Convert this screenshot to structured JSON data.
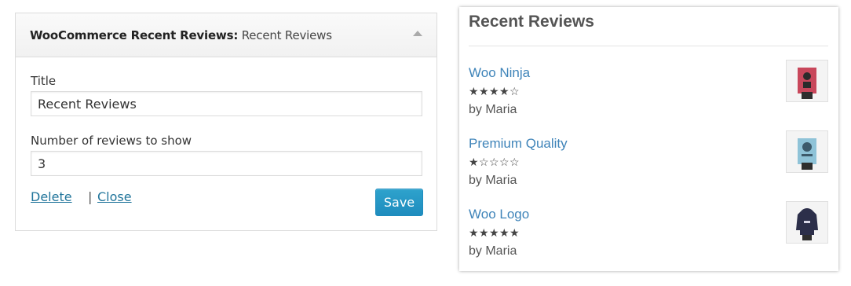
{
  "widget": {
    "header_main": "WooCommerce Recent Reviews:",
    "header_sub": " Recent Reviews",
    "title_label": "Title",
    "title_value": "Recent Reviews",
    "count_label": "Number of reviews to show",
    "count_value": "3",
    "delete_link": "Delete",
    "separator": "|",
    "close_link": "Close",
    "save_button": "Save",
    "toggle_icon": "triangle-up-icon"
  },
  "preview": {
    "heading": "Recent Reviews",
    "reviews": [
      {
        "product": "Woo Ninja",
        "rating": 4,
        "max_rating": 5,
        "author": "by Maria",
        "thumbnail": "poster-ninja-image"
      },
      {
        "product": "Premium Quality",
        "rating": 1,
        "max_rating": 5,
        "author": "by Maria",
        "thumbnail": "poster-premium-quality-image"
      },
      {
        "product": "Woo Logo",
        "rating": 5,
        "max_rating": 5,
        "author": "by Maria",
        "thumbnail": "hoodie-woo-logo-image"
      }
    ]
  },
  "colors": {
    "link": "#21759b",
    "review_link": "#3f84b9",
    "save_button": "#2ea2cc"
  }
}
